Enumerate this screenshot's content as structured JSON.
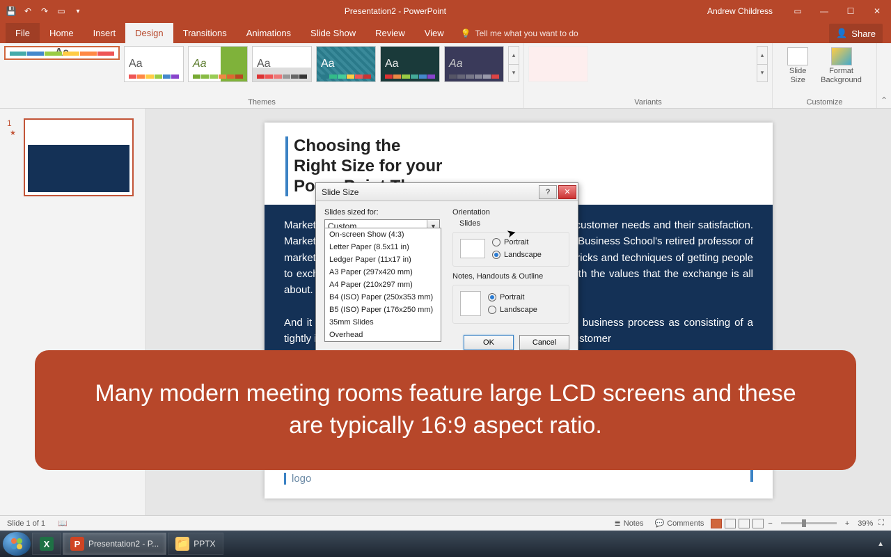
{
  "title": "Presentation2 - PowerPoint",
  "user": "Andrew Childress",
  "tabs": {
    "file": "File",
    "home": "Home",
    "insert": "Insert",
    "design": "Design",
    "transitions": "Transitions",
    "animations": "Animations",
    "slideshow": "Slide Show",
    "review": "Review",
    "view": "View"
  },
  "tellme": "Tell me what you want to do",
  "share": "Share",
  "groups": {
    "themes": "Themes",
    "variants": "Variants",
    "customize": "Customize"
  },
  "customize": {
    "size": "Slide\nSize",
    "format": "Format\nBackground"
  },
  "slide_n": "1",
  "slide_title": "Choosing the\nRight Size for your\nPowerPoint Theme",
  "slide_body": "Marketing is based on thinking about the business in terms of customer needs and their satisfaction. Marketing differs from selling because (in the words of Harvard Business School's retired professor of marketing Theodore C. Levitt) \"Selling concerns itself with the tricks and techniques of getting people to exchange their cash for your product. It is not concerned with the values that the exchange is all about.\n\nAnd it does not, as marketing invariable does, view the entire business process as consisting of a tightly integrated effort to discover, create, arouse and satisfy customer",
  "logo": "logo",
  "dialog": {
    "title": "Slide Size",
    "sized_for": "Slides sized for:",
    "selected": "Custom",
    "options": [
      "On-screen Show (4:3)",
      "Letter Paper (8.5x11 in)",
      "Ledger Paper (11x17 in)",
      "A3 Paper (297x420 mm)",
      "A4 Paper (210x297 mm)",
      "B4 (ISO) Paper (250x353 mm)",
      "B5 (ISO) Paper (176x250 mm)",
      "35mm Slides",
      "Overhead"
    ],
    "orientation": "Orientation",
    "slides": "Slides",
    "notes": "Notes, Handouts & Outline",
    "portrait": "Portrait",
    "landscape": "Landscape",
    "ok": "OK",
    "cancel": "Cancel"
  },
  "caption": "Many modern meeting rooms feature large LCD screens and these are typically 16:9 aspect ratio.",
  "status": {
    "slide": "Slide 1 of 1",
    "notes": "Notes",
    "comments": "Comments",
    "zoom": "39%"
  },
  "taskbar": {
    "ppt": "Presentation2 - P...",
    "folder": "PPTX"
  }
}
